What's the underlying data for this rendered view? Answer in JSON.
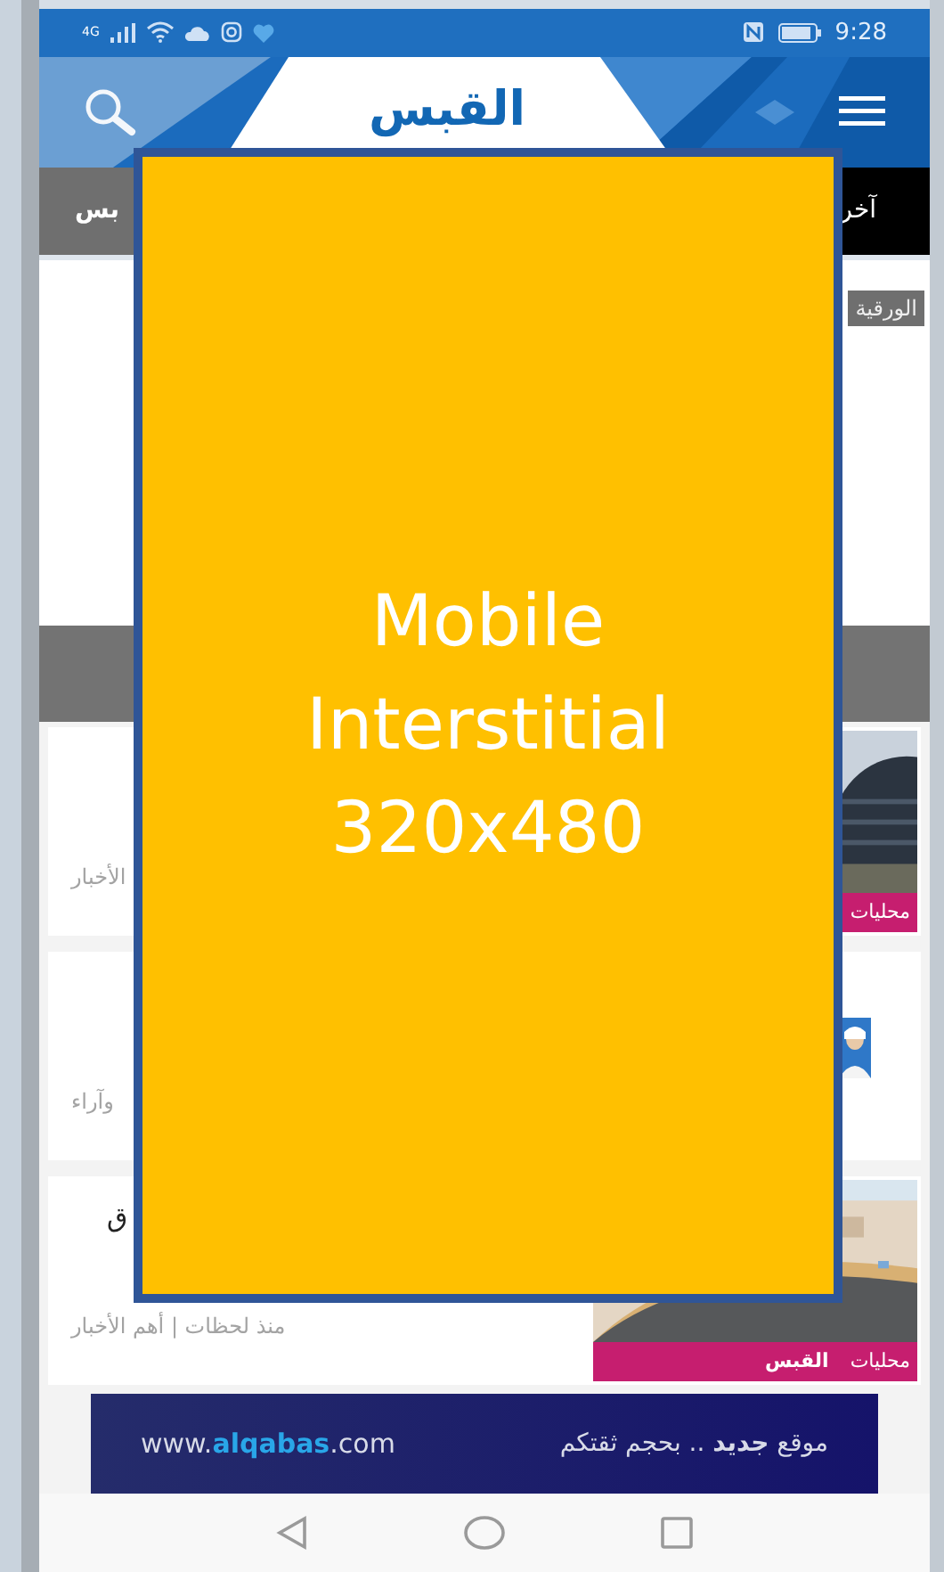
{
  "status_bar": {
    "network": "4G",
    "time": "9:28"
  },
  "header": {
    "logo": "القبس"
  },
  "ticker": {
    "left_text": "بس",
    "right_text": "آخر"
  },
  "featured": {
    "tag": "الورقية"
  },
  "cards": [
    {
      "tag": "محليات",
      "meta": "الأخبار"
    },
    {
      "kind": "portrait",
      "meta": "وآراء"
    },
    {
      "kind": "wide",
      "title": "ق",
      "tag": "محليات",
      "tag_logo": "القبس",
      "meta": "منذ لحظات | أهم الأخبار"
    }
  ],
  "banner": {
    "url": "www.**alqabas**.com",
    "slogan": "موقع **جديد** .. بحجم ثقتكم"
  },
  "ad": {
    "lines": [
      "Mobile",
      "Interstitial",
      "320x480"
    ]
  }
}
